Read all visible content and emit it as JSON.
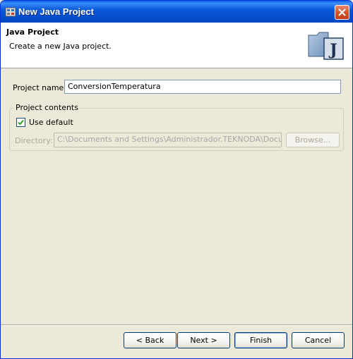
{
  "window": {
    "title": "New Java Project",
    "icon": "java-project-wizard-icon",
    "close_icon": "close-icon"
  },
  "banner": {
    "title": "Java Project",
    "description": "Create a new Java project.",
    "image_icon": "java-folder-icon",
    "image_letter": "J"
  },
  "form": {
    "project_name_label": "Project name:",
    "project_name_value": "ConversionTemperatura",
    "project_contents_label": "Project contents",
    "use_default_label": "Use default",
    "use_default_checked": true,
    "directory_label": "Directory:",
    "directory_value": "C:\\Documents and Settings\\Administrador.TEKNODA\\Documents\\",
    "browse_label": "Browse..."
  },
  "buttons": {
    "back": "< Back",
    "next": "Next >",
    "finish": "Finish",
    "cancel": "Cancel"
  },
  "colors": {
    "titlebar": "#0a5bd9",
    "dialog_background": "#ece9d8",
    "close_button": "#d5522a",
    "field_border": "#7f9db9"
  }
}
